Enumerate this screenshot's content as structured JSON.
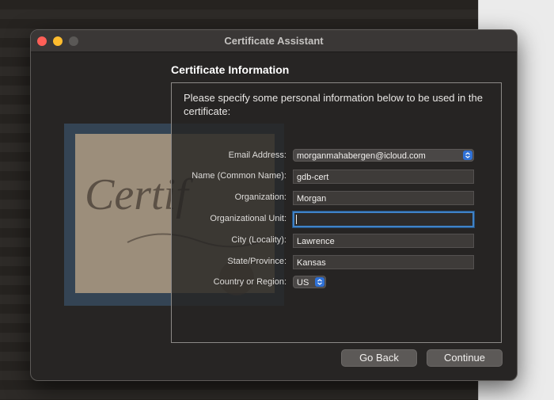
{
  "window": {
    "title": "Certificate Assistant"
  },
  "heading": "Certificate Information",
  "instructions": "Please specify some personal information below to be used in the certificate:",
  "fields": [
    {
      "label": "Email Address:",
      "value": "morganmahabergen@icloud.com"
    },
    {
      "label": "Name (Common Name):",
      "value": "gdb-cert"
    },
    {
      "label": "Organization:",
      "value": "Morgan"
    },
    {
      "label": "Organizational Unit:",
      "value": ""
    },
    {
      "label": "City (Locality):",
      "value": "Lawrence"
    },
    {
      "label": "State/Province:",
      "value": "Kansas"
    },
    {
      "label": "Country or Region:",
      "value": "US"
    }
  ],
  "buttons": {
    "back": "Go Back",
    "continue": "Continue"
  },
  "art": {
    "text": "Certif"
  },
  "colors": {
    "accent": "#2f71d6",
    "focus_ring": "#3f82c7"
  }
}
